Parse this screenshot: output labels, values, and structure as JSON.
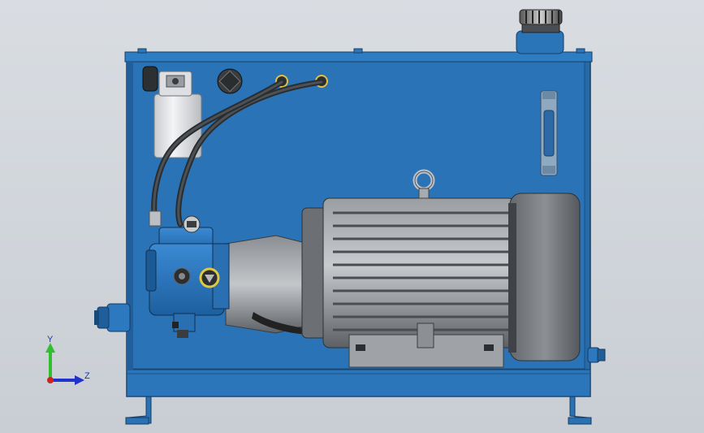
{
  "viewport": {
    "background_top": "#d9dde2",
    "background_bottom": "#c9ced4"
  },
  "model": {
    "tank_color": "#2870b4",
    "tank_edge_color": "#1d5590",
    "motor_color": "#7d8185",
    "pump_color": "#2a78c2",
    "filter_color": "#e8e8ea"
  },
  "triad": {
    "y_label": "Y",
    "z_label": "Z",
    "y_color": "#2fbf2f",
    "z_color": "#2233cc",
    "x_color": "#cc2222"
  }
}
